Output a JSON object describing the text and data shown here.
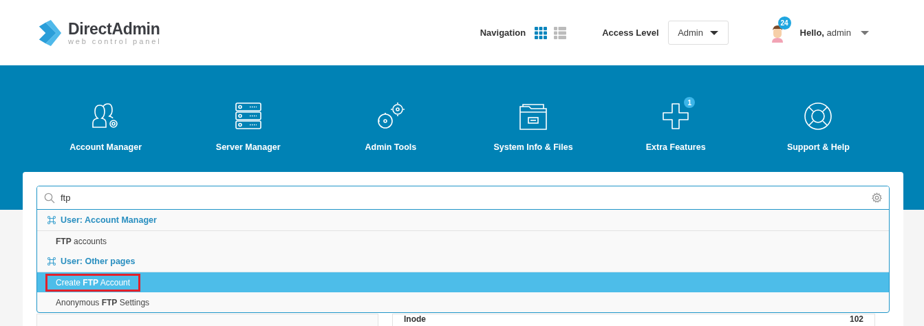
{
  "brand": {
    "name": "DirectAdmin",
    "tagline": "web control panel"
  },
  "header": {
    "navigation_label": "Navigation",
    "grid_view_selected": true,
    "access_label": "Access Level",
    "access_value": "Admin",
    "notifications": "24",
    "greeting": "Hello,",
    "user": "admin"
  },
  "nav": [
    {
      "kind": "account",
      "label": "Account Manager"
    },
    {
      "kind": "server",
      "label": "Server Manager"
    },
    {
      "kind": "tools",
      "label": "Admin Tools"
    },
    {
      "kind": "files",
      "label": "System Info & Files"
    },
    {
      "kind": "plus",
      "label": "Extra Features",
      "badge": "1"
    },
    {
      "kind": "support",
      "label": "Support & Help"
    }
  ],
  "search": {
    "value": "ftp"
  },
  "results": [
    {
      "group": "User: Account Manager",
      "items": [
        {
          "text": "**FTP** accounts",
          "selected": false,
          "highlighted": false
        }
      ]
    },
    {
      "group": "User: Other pages",
      "items": [
        {
          "text": "Create **FTP** Account",
          "selected": true,
          "highlighted": true
        },
        {
          "text": "Anonymous **FTP** Settings",
          "selected": false,
          "highlighted": false
        }
      ]
    }
  ],
  "table": {
    "label": "Inode",
    "value": "102"
  }
}
